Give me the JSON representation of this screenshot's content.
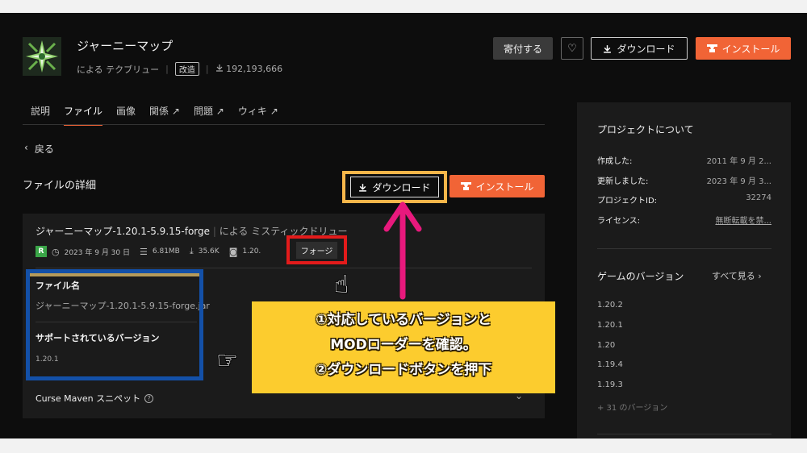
{
  "header": {
    "title": "ジャーニーマップ",
    "by_label": "による",
    "author": "テクブリュー",
    "badge": "改造",
    "downloads": "192,193,666",
    "tip_label": "寄付する",
    "download_label": "ダウンロード",
    "install_label": "インストール"
  },
  "tabs": [
    {
      "label": "説明"
    },
    {
      "label": "ファイル"
    },
    {
      "label": "画像"
    },
    {
      "label": "関係"
    },
    {
      "label": "問題"
    },
    {
      "label": "ウィキ"
    }
  ],
  "back_label": "戻る",
  "section_title": "ファイルの詳細",
  "file": {
    "name": "ジャーニーマップ-1.20.1-5.9.15-forge",
    "by": "による",
    "uploader": "ミスティックドリュー",
    "release_badge": "R",
    "date": "2023 年 9 月 30 日",
    "size": "6.81MB",
    "downloads": "35.6K",
    "game_version": "1.20.",
    "loader": "フォージ",
    "filename_label": "ファイル名",
    "filename": "ジャーニーマップ-1.20.1-5.9.15-forge.jar",
    "supported_label": "サポートされているバージョン",
    "supported_version": "1.20.1",
    "snippet_label": "Curse Maven スニペット"
  },
  "sidebar": {
    "about_title": "プロジェクトについて",
    "info": [
      {
        "key": "作成した:",
        "value": "2011 年 9 月 2..."
      },
      {
        "key": "更新しました:",
        "value": "2023 年 9 月 3..."
      },
      {
        "key": "プロジェクトID:",
        "value": "32274"
      },
      {
        "key": "ライセンス:",
        "value": "無断転載を禁..."
      }
    ],
    "game_versions_title": "ゲームのバージョン",
    "see_all": "すべて見る",
    "versions": [
      "1.20.2",
      "1.20.1",
      "1.20",
      "1.19.4",
      "1.19.3"
    ],
    "more_versions": "+ 31 のバージョン"
  },
  "annotation": {
    "line1": "①対応しているバージョンと",
    "line2": "MODローダーを確認。",
    "line3": "②ダウンロードボタンを押下"
  },
  "colors": {
    "accent": "#f16436",
    "highlight_orange": "#f7b64a",
    "highlight_red": "#e31b1b",
    "highlight_blue": "#1350a8",
    "arrow_pink": "#e8197d",
    "callout_yellow": "#fccc2e"
  }
}
